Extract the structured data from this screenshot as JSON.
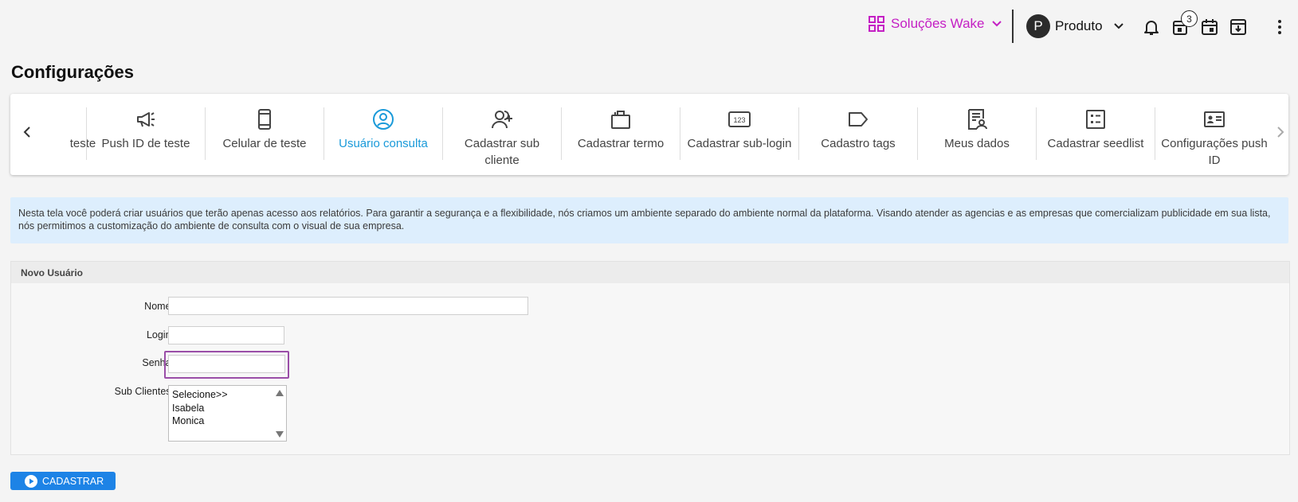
{
  "header": {
    "solutions_label": "Soluções Wake",
    "user_initial": "P",
    "user_name": "Produto",
    "notification_badge": "3"
  },
  "page_title": "Configurações",
  "tabs": [
    {
      "label": "teste",
      "icon": "partial-icon",
      "active": false
    },
    {
      "label": "Push ID de teste",
      "icon": "megaphone-icon",
      "active": false
    },
    {
      "label": "Celular de teste",
      "icon": "smartphone-icon",
      "active": false
    },
    {
      "label": "Usuário consulta",
      "icon": "user-circle-icon",
      "active": true
    },
    {
      "label": "Cadastrar sub cliente",
      "icon": "add-user-icon",
      "active": false
    },
    {
      "label": "Cadastrar termo",
      "icon": "briefcase-icon",
      "active": false
    },
    {
      "label": "Cadastrar sub-login",
      "icon": "pin-123-icon",
      "active": false
    },
    {
      "label": "Cadastro tags",
      "icon": "tag-icon",
      "active": false
    },
    {
      "label": "Meus dados",
      "icon": "user-document-icon",
      "active": false
    },
    {
      "label": "Cadastrar seedlist",
      "icon": "checklist-icon",
      "active": false
    },
    {
      "label": "Configurações push ID",
      "icon": "id-card-icon",
      "active": false
    }
  ],
  "info_text": "Nesta tela você poderá criar usuários que terão apenas acesso aos relatórios. Para garantir a segurança e a flexibilidade, nós criamos um ambiente separado do ambiente normal da plataforma. Visando atender as agencias e as empresas que comercializam publicidade em sua lista, nós permitimos a customização do ambiente de consulta com o visual de sua empresa.",
  "form": {
    "title": "Novo Usuário",
    "nome_label": "Nome:",
    "nome_value": "",
    "login_label": "Login:",
    "login_value": "",
    "senha_label": "Senha:",
    "senha_value": "",
    "subclientes_label": "Sub Clientes:",
    "subclientes_options": [
      "Selecione>>",
      "Isabela",
      "Monica"
    ]
  },
  "submit_label": "CADASTRAR",
  "colors": {
    "accent_purple": "#c41fc4",
    "active_tab_blue": "#1a9ad9",
    "button_blue": "#1d83e6",
    "info_bg": "#ddeefd",
    "focus_purple": "#9a4ea8"
  }
}
